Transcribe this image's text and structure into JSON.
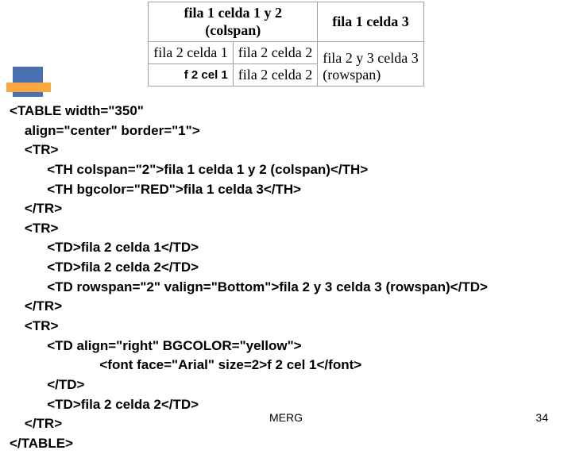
{
  "chart_data": {
    "type": "table",
    "rows": [
      {
        "cells": [
          {
            "text": "fila 1 celda 1 y 2\n(colspan)",
            "th": true,
            "colspan": 2
          },
          {
            "text": "fila 1 celda 3",
            "th": true,
            "bg": "red"
          }
        ]
      },
      {
        "cells": [
          {
            "text": "fila 2 celda 1"
          },
          {
            "text": "fila 2 celda 2"
          },
          {
            "text": "fila 2 y 3 celda 3\n(rowspan)",
            "rowspan": 2,
            "valign": "bottom"
          }
        ]
      },
      {
        "cells": [
          {
            "text": "f 2 cel 1",
            "align": "right",
            "bg": "yellow",
            "font": "Arial"
          },
          {
            "text": "fila 2 celda 2"
          }
        ]
      }
    ]
  },
  "table": {
    "r1c12a": "fila 1 celda 1 y 2",
    "r1c12b": "(colspan)",
    "r1c3": "fila 1 celda 3",
    "r2c1": "fila 2 celda 1",
    "r2c2": "fila 2 celda 2",
    "r23c3a": "fila 2 y 3 celda 3",
    "r23c3b": "(rowspan)",
    "r3c1": "f 2 cel 1",
    "r3c2": "fila 2 celda 2"
  },
  "code": {
    "l01": "<TABLE width=\"350\"",
    "l02": "    align=\"center\" border=\"1\">",
    "l03": "    <TR>",
    "l04": "          <TH colspan=\"2\">fila 1 celda 1 y 2 (colspan)</TH>",
    "l05": "          <TH bgcolor=\"RED\">fila 1 celda 3</TH>",
    "l06": "    </TR>",
    "l07": "    <TR>",
    "l08": "          <TD>fila 2 celda 1</TD>",
    "l09": "          <TD>fila 2 celda 2</TD>",
    "l10": "          <TD rowspan=\"2\" valign=\"Bottom\">fila 2 y 3 celda 3 (rowspan)</TD>",
    "l11": "    </TR>",
    "l12": "    <TR>",
    "l13": "          <TD align=\"right\" BGCOLOR=\"yellow\">",
    "l14": "                        <font face=\"Arial\" size=2>f 2 cel 1</font>",
    "l15": "          </TD>",
    "l16": "          <TD>fila 2 celda 2</TD>",
    "l17": "    </TR>",
    "l18": "</TABLE>"
  },
  "footer": {
    "center": "MERG",
    "page": "34"
  }
}
